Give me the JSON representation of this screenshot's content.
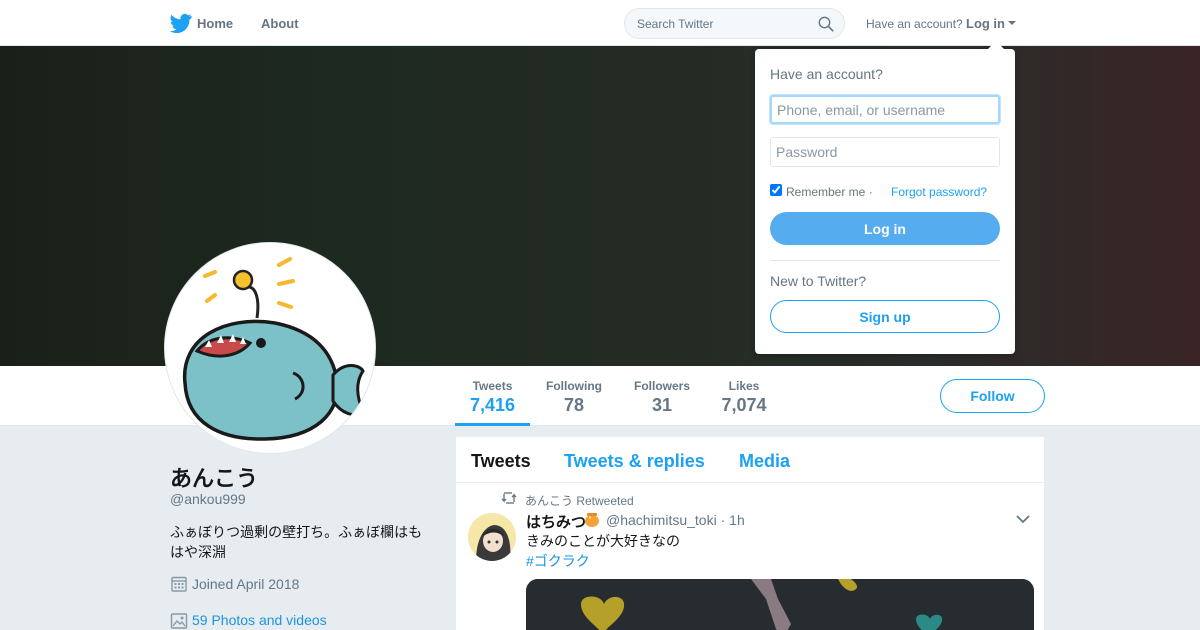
{
  "colors": {
    "accent": "#1da1f2",
    "login_button": "#55acee",
    "muted_text": "#657786",
    "page_bg": "#e6ecf0"
  },
  "nav": {
    "logo_icon": "twitter-bird-icon",
    "home_label": "Home",
    "about_label": "About",
    "search_placeholder": "Search Twitter",
    "search_icon": "search-icon",
    "have_account_text": "Have an account?",
    "login_label": "Log in"
  },
  "profile": {
    "display_name": "あんこう",
    "handle": "@ankou999",
    "bio": "ふぁぼりつ過剰の壁打ち。ふぁぼ欄はもはや深淵",
    "joined": "Joined April 2018",
    "photos_link": "59 Photos and videos",
    "avatar_icon": "anglerfish-avatar-icon"
  },
  "stats": [
    {
      "label": "Tweets",
      "value": "7,416",
      "active": true
    },
    {
      "label": "Following",
      "value": "78",
      "active": false
    },
    {
      "label": "Followers",
      "value": "31",
      "active": false
    },
    {
      "label": "Likes",
      "value": "7,074",
      "active": false
    }
  ],
  "follow_label": "Follow",
  "timeline": {
    "tabs": [
      {
        "label": "Tweets",
        "active": true
      },
      {
        "label": "Tweets & replies",
        "active": false
      },
      {
        "label": "Media",
        "active": false
      }
    ],
    "tweet": {
      "retweeted_by": "あんこう Retweeted",
      "author_name": "はちみつ",
      "author_handle": "@hachimitsu_toki",
      "time": "1h",
      "text": "きみのことが大好きなの",
      "hashtag": "#ゴクラク"
    }
  },
  "login_dropdown": {
    "heading": "Have an account?",
    "username_placeholder": "Phone, email, or username",
    "password_placeholder": "Password",
    "remember_label": "Remember me",
    "separator": "·",
    "forgot_label": "Forgot password?",
    "remember_checked": true,
    "login_button": "Log in",
    "new_to_text": "New to Twitter?",
    "signup_button": "Sign up"
  }
}
